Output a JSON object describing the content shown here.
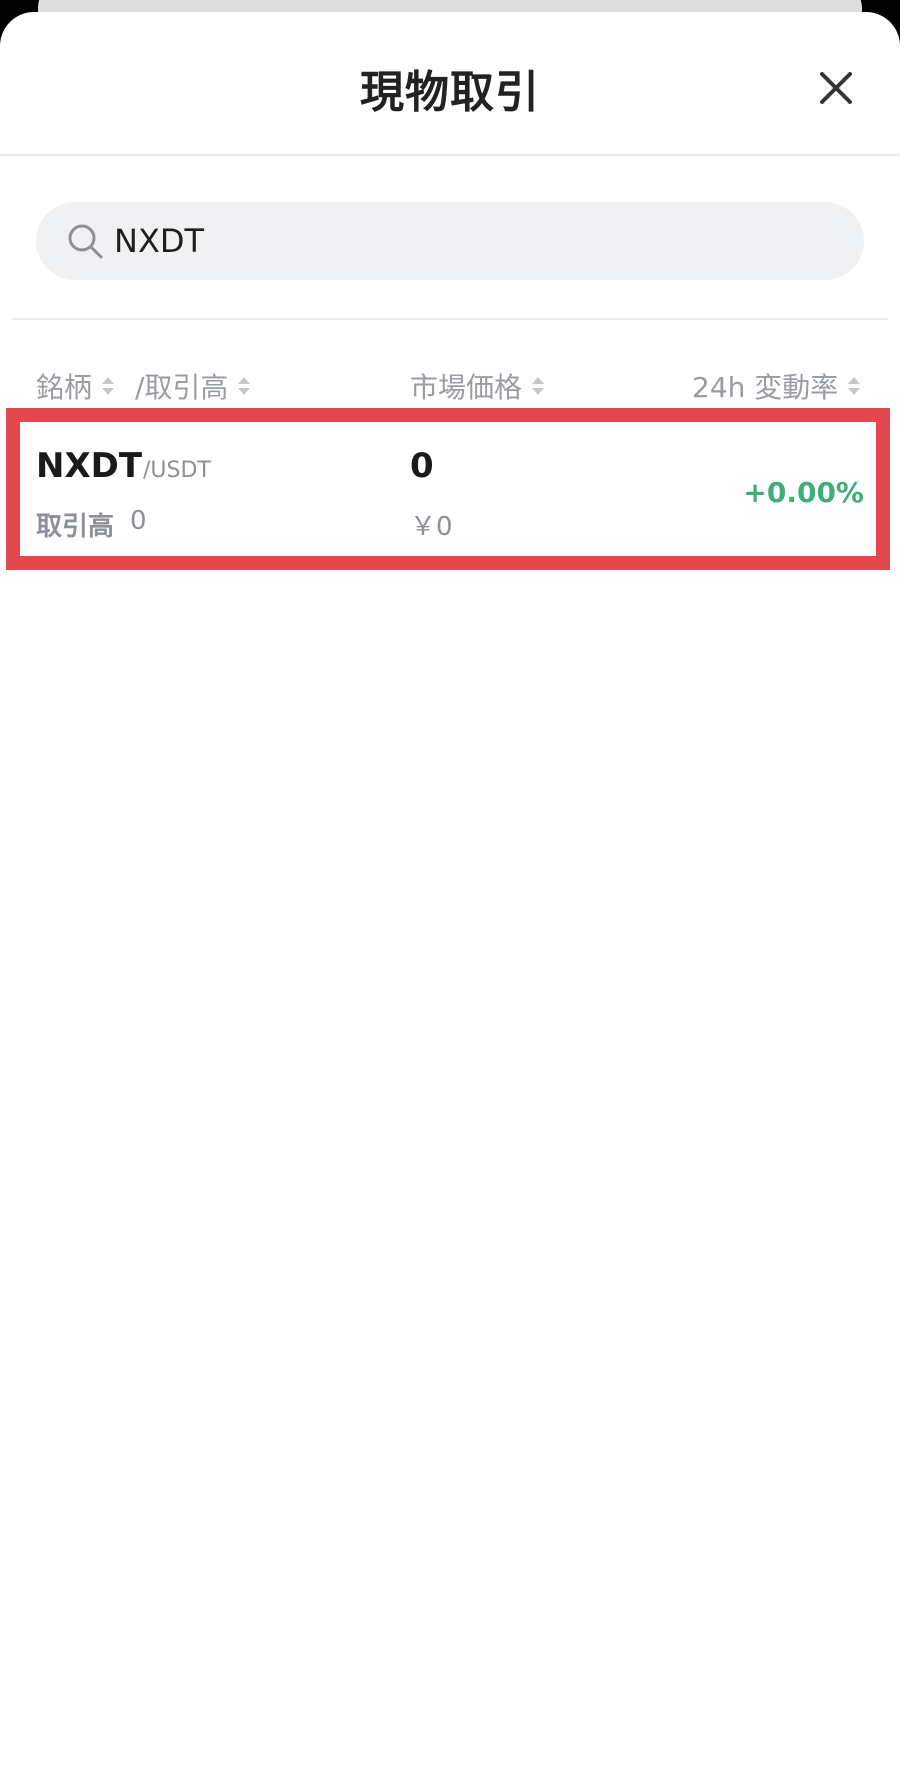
{
  "header": {
    "title": "現物取引",
    "close_icon": "close-icon"
  },
  "search": {
    "value": "NXDT",
    "icon": "search-icon"
  },
  "columns": {
    "symbol": "銘柄",
    "volume": "/取引高",
    "price": "市場価格",
    "change": "24h 変動率"
  },
  "results": [
    {
      "symbol": "NXDT",
      "quote": "/USDT",
      "volume_label": "取引高",
      "volume": "0",
      "price": "0",
      "price_jpy": "￥0",
      "change": "+0.00%"
    }
  ],
  "colors": {
    "positive": "#3fae78",
    "highlight": "#e5474f"
  }
}
